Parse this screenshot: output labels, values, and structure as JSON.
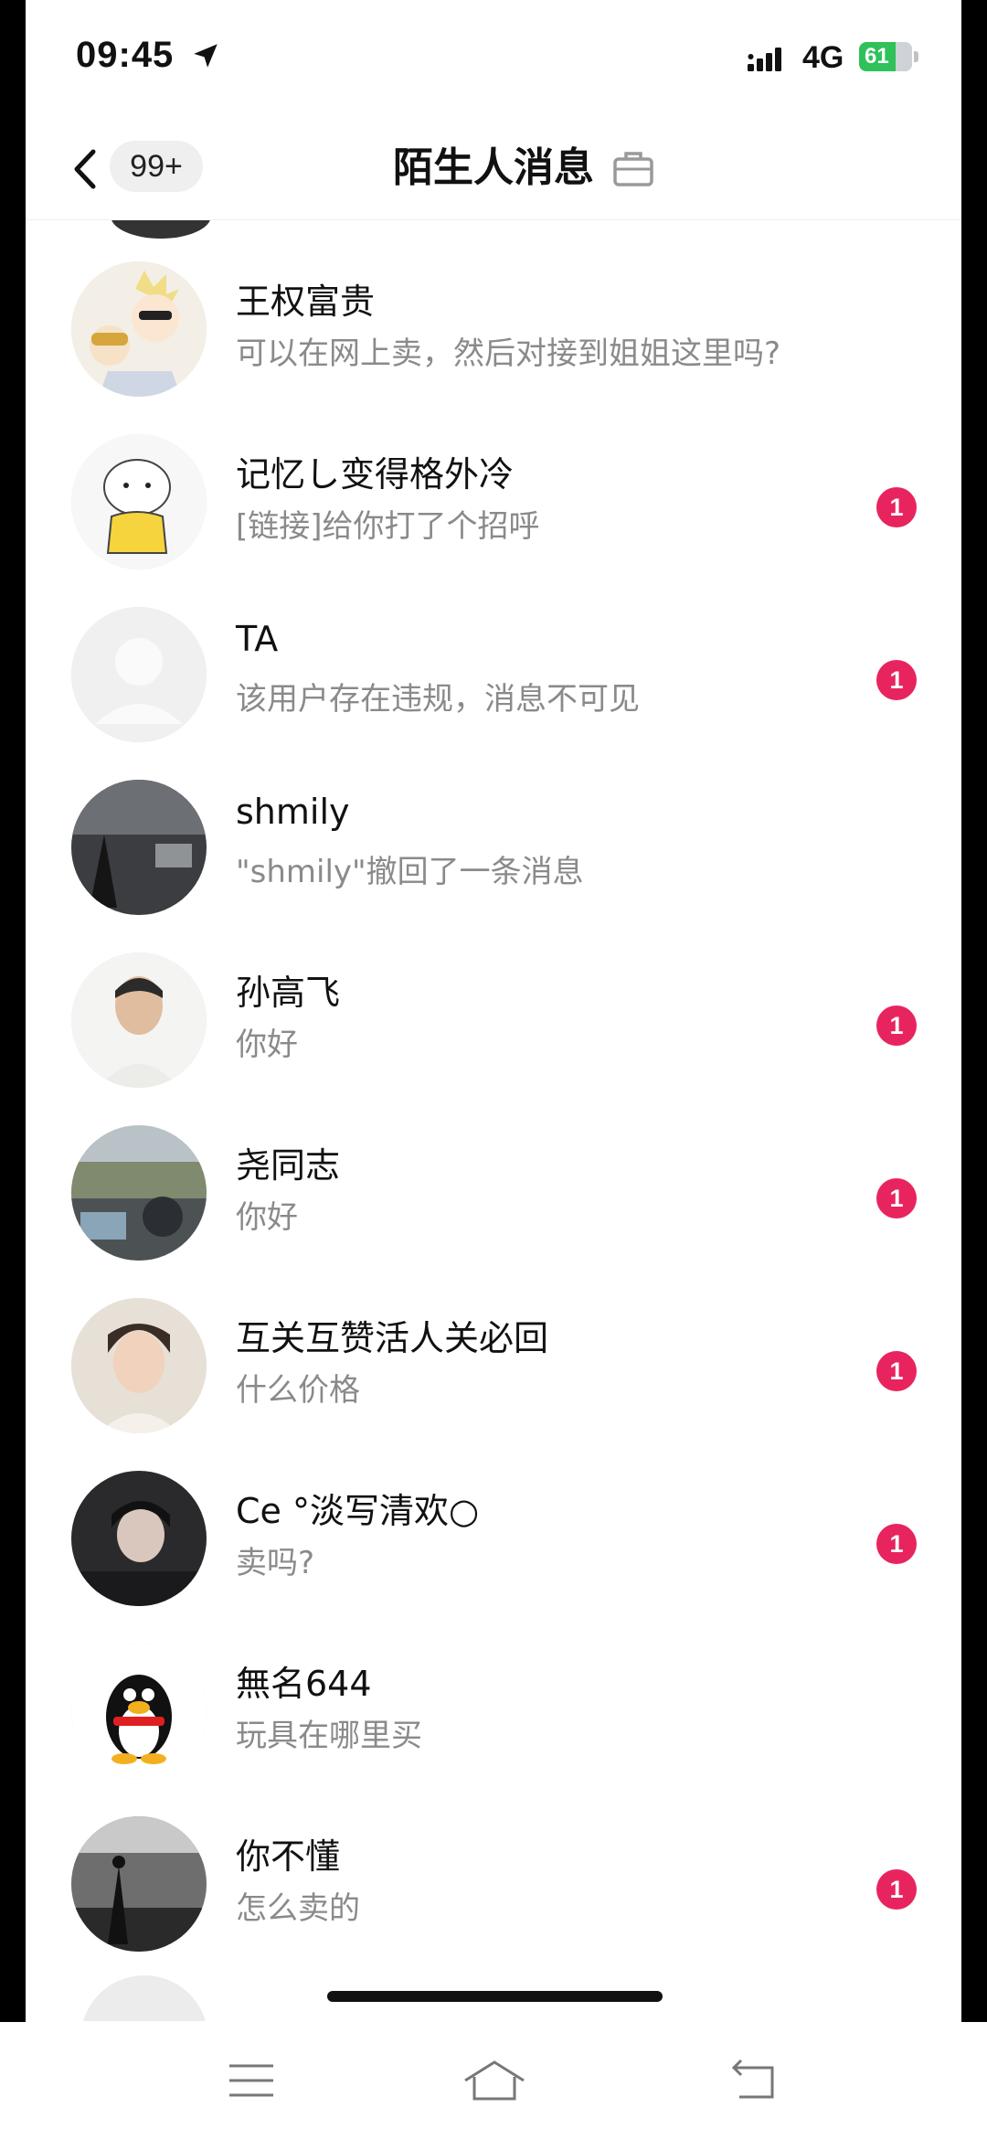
{
  "status_bar": {
    "time": "09:45",
    "network": "4G",
    "battery": "61"
  },
  "header": {
    "unread_badge": "99+",
    "title": "陌生人消息"
  },
  "conversations": [
    {
      "name": "王权富贵",
      "preview": "可以在网上卖，然后对接到姐姐这里吗?",
      "unread": "",
      "avatar": "anime-couple-avatar"
    },
    {
      "name": "记忆し变得格外冷",
      "preview": "[链接]给你打了个招呼",
      "unread": "1",
      "avatar": "cartoon-character-avatar"
    },
    {
      "name": "TA",
      "preview": "该用户存在违规，消息不可见",
      "unread": "1",
      "avatar": "default-user-avatar"
    },
    {
      "name": "shmily",
      "preview": "\"shmily\"撤回了一条消息",
      "unread": "",
      "avatar": "dark-street-photo-avatar"
    },
    {
      "name": "孙高飞",
      "preview": "你好",
      "unread": "1",
      "avatar": "portrait-photo-avatar"
    },
    {
      "name": "尧同志",
      "preview": "你好",
      "unread": "1",
      "avatar": "outdoor-photo-avatar"
    },
    {
      "name": "互关互赞活人关必回",
      "preview": "什么价格",
      "unread": "1",
      "avatar": "portrait-photo-avatar"
    },
    {
      "name": "Ce °淡写清欢○",
      "preview": "卖吗?",
      "unread": "1",
      "avatar": "anime-dark-avatar"
    },
    {
      "name": "無名644",
      "preview": "玩具在哪里买",
      "unread": "",
      "avatar": "penguin-avatar"
    },
    {
      "name": "你不懂",
      "preview": "怎么卖的",
      "unread": "1",
      "avatar": "street-silhouette-avatar"
    }
  ],
  "colors": {
    "unread_badge": "#e8245f",
    "battery": "#2fc15a",
    "name_text": "#111111",
    "preview_text": "#8a8a8a"
  },
  "nav_icons": [
    "menu-icon",
    "home-icon",
    "back-icon"
  ]
}
